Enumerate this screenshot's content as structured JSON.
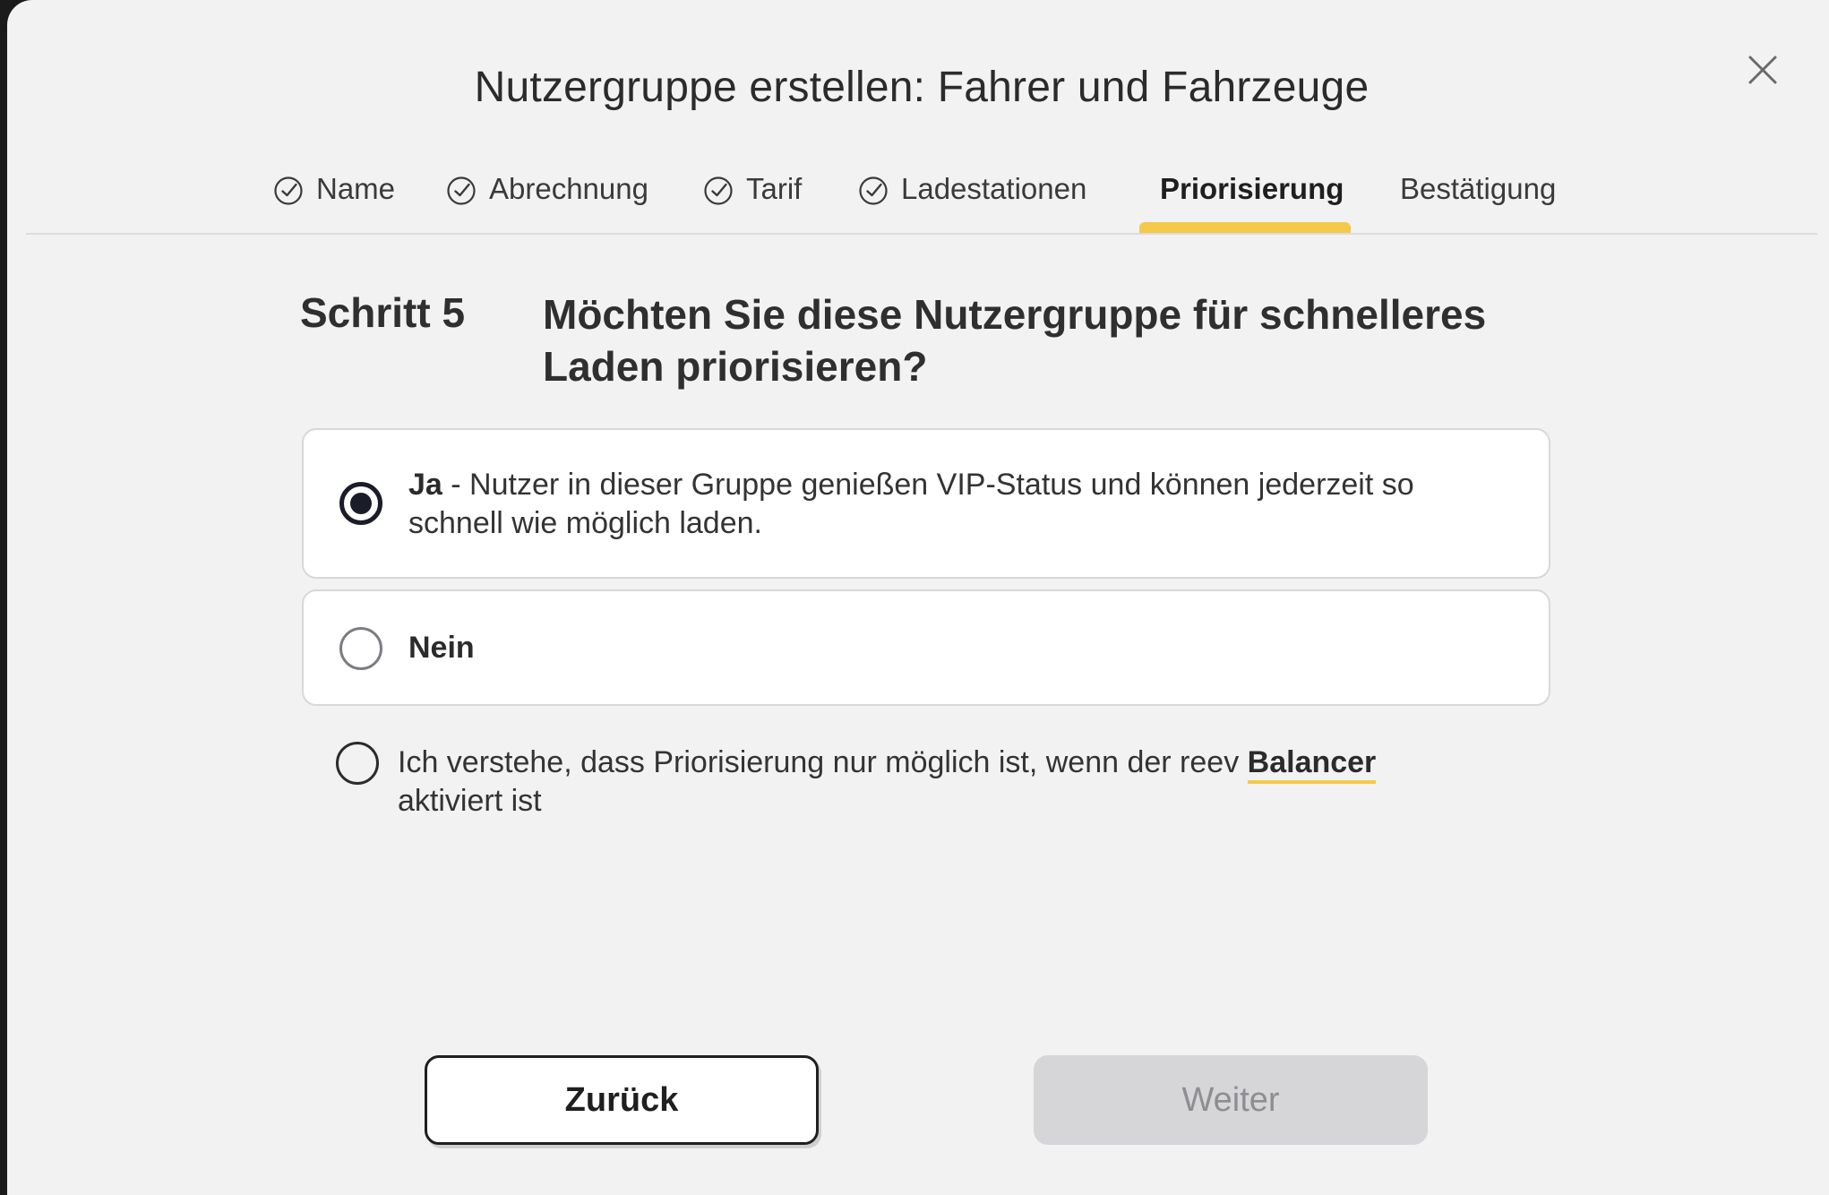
{
  "modal": {
    "title": "Nutzergruppe erstellen: Fahrer und Fahrzeuge",
    "close_icon": "close-icon"
  },
  "tabs": [
    {
      "label": "Name",
      "completed": true,
      "active": false
    },
    {
      "label": "Abrechnung",
      "completed": true,
      "active": false
    },
    {
      "label": "Tarif",
      "completed": true,
      "active": false
    },
    {
      "label": "Ladestationen",
      "completed": true,
      "active": false
    },
    {
      "label": "Priorisierung",
      "completed": false,
      "active": true
    },
    {
      "label": "Bestätigung",
      "completed": false,
      "active": false
    }
  ],
  "step": {
    "label": "Schritt 5",
    "question": "Möchten Sie diese Nutzergruppe für schnelleres Laden priorisieren?"
  },
  "options": [
    {
      "key": "Ja",
      "description": " - Nutzer in dieser Gruppe genießen VIP-Status und können jederzeit so schnell wie möglich laden.",
      "selected": true
    },
    {
      "key": "Nein",
      "description": "",
      "selected": false
    }
  ],
  "consent": {
    "text_before": "Ich verstehe, dass Priorisierung nur möglich ist, wenn der reev ",
    "link_text": "Balancer",
    "text_after": " aktiviert ist",
    "checked": false
  },
  "buttons": {
    "back_label": "Zurück",
    "next_label": "Weiter",
    "next_disabled": true
  },
  "colors": {
    "accent": "#f5c94a",
    "background": "#f2f2f2",
    "radio_selected": "#1a1c27",
    "button_disabled": "#d6d6d8"
  }
}
